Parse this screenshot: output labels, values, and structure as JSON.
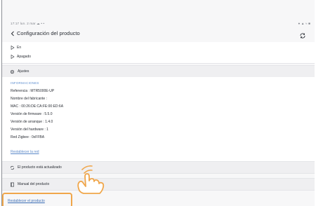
{
  "status_bar": {
    "time_date": "17:17  lun. 2 mar  ☁ • •",
    "indicators": "● ▲ ≈ ■"
  },
  "header": {
    "title": "Configuración del producto",
    "back_icon": "chevron-left",
    "refresh_icon": "refresh"
  },
  "scenarios": [
    {
      "label": "En",
      "icon": "play"
    },
    {
      "label": "Apagado",
      "icon": "play"
    }
  ],
  "settings_section": {
    "label": "Ajustes",
    "icon": "gear"
  },
  "info": {
    "heading": "INFORMACIONES",
    "rows": [
      "Referencia : MTR5000E-UP",
      "Nombre del fabricante :",
      "MAC : 00:26:DE:CA:FE:00:ED:6A",
      "Versión de firmware : 5.5.0",
      "Versión de arranque : 1.4.0",
      "Versión del hardware : 1",
      "Red Zigbee : 0xFFBA"
    ],
    "reset_network_link": "Restablecer la red"
  },
  "update_section": {
    "label": "El producto está actualizado",
    "icon": "refresh"
  },
  "manual_section": {
    "label": "Manual del producto",
    "icon": "book"
  },
  "footer": {
    "reset_product_link": "Restablecer el producto"
  },
  "annotation": {
    "highlight_color": "#f0a64a",
    "gesture": "tap-hand"
  }
}
